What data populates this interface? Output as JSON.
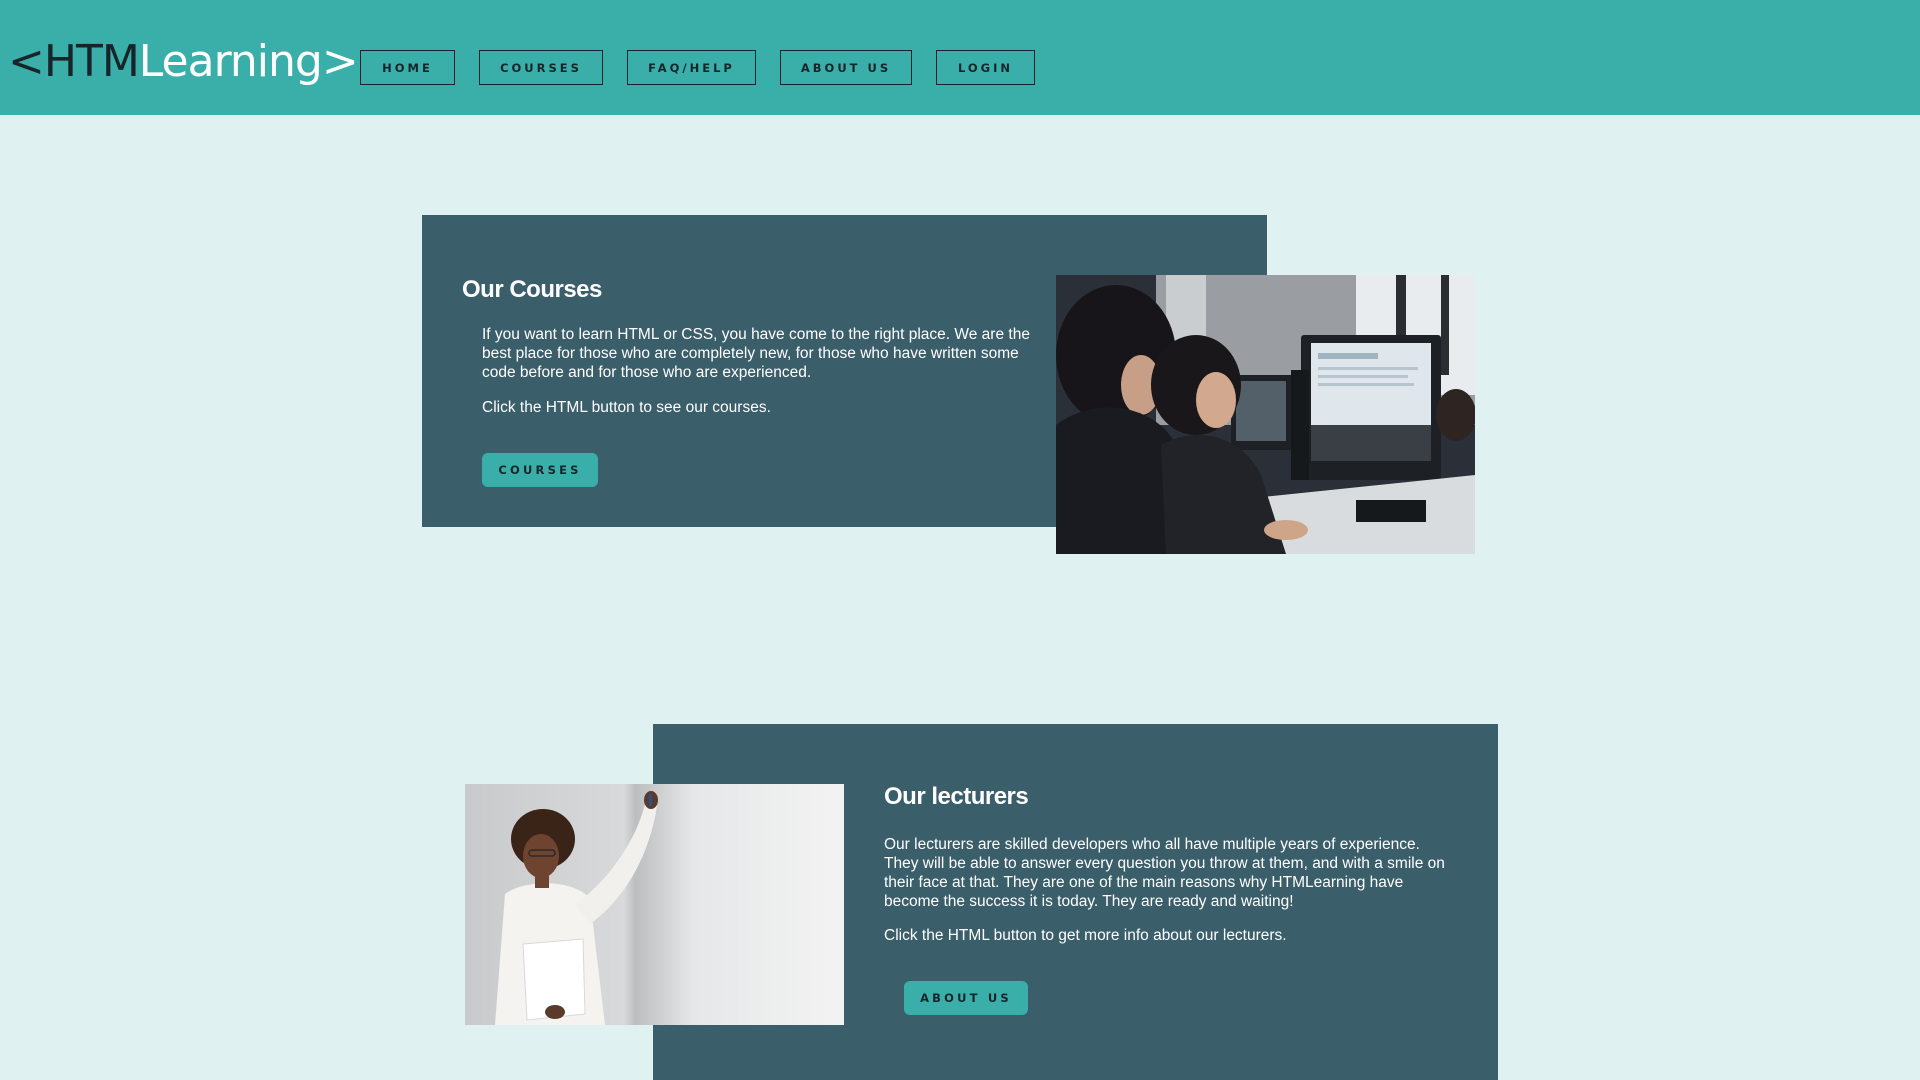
{
  "header": {
    "logo_left": "<HTM",
    "logo_right": "Learning>",
    "nav": {
      "home": "HOME",
      "courses": "COURSES",
      "faq": "FAQ/HELP",
      "about": "ABOUT US",
      "login": "LOGIN"
    }
  },
  "courses_section": {
    "title": "Our Courses",
    "paragraph_1": "If you want to learn HTML or CSS, you have come to the right place. We are the best place for those who are completely new, for those who have written some code before and for those who are experienced.",
    "paragraph_2": "Click the HTML button to see our courses.",
    "button": "COURSES",
    "image": "students-at-computers-photo"
  },
  "lecturers_section": {
    "title": "Our lecturers",
    "paragraph_1": "Our lecturers are skilled developers who all have multiple years of experience. They will be able to answer every question you throw at them, and with a smile on their face at that. They are one of the main reasons why HTMLearning have become the success it is today. They are ready and waiting!",
    "paragraph_2": "Click the HTML button to get more info about our lecturers.",
    "button": "ABOUT US",
    "image": "lecturer-at-whiteboard-photo"
  },
  "colors": {
    "header_bg": "#3aafa9",
    "page_bg": "#dff1f0",
    "panel_bg": "#3b5e6b",
    "dark_text": "#17252a",
    "accent": "#3aafa9"
  }
}
